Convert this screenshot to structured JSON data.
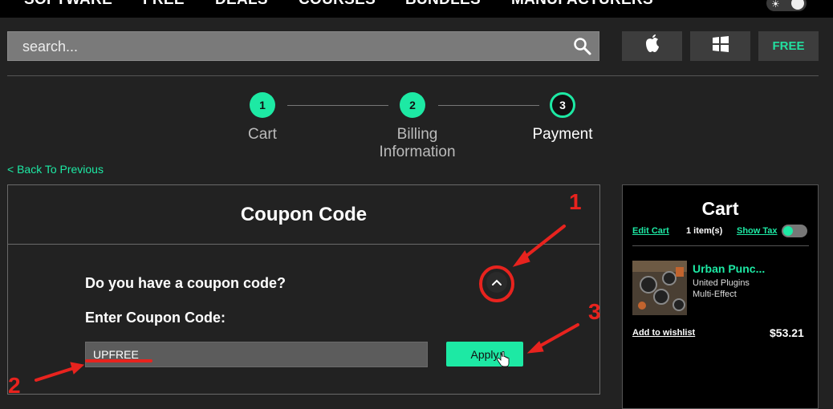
{
  "nav": {
    "items": [
      "SOFTWARE",
      "FREE",
      "DEALS",
      "COURSES",
      "BUNDLES",
      "MANUFACTURERS"
    ]
  },
  "search": {
    "placeholder": "search..."
  },
  "platform_buttons": {
    "apple_icon": "apple-icon",
    "windows_icon": "windows-icon",
    "free_label": "FREE"
  },
  "steps": [
    {
      "number": "1",
      "label": "Cart"
    },
    {
      "number": "2",
      "label": "Billing",
      "label2": "Information"
    },
    {
      "number": "3",
      "label": "Payment"
    }
  ],
  "back_link": "< Back To Previous",
  "coupon": {
    "title": "Coupon Code",
    "question": "Do you have a coupon code?",
    "enter_label": "Enter Coupon Code:",
    "value": "UPFREE",
    "apply_label": "Apply"
  },
  "cart": {
    "title": "Cart",
    "edit_label": "Edit Cart",
    "items_count": "1 item(s)",
    "show_tax_label": "Show Tax",
    "product": {
      "name": "Urban Punc...",
      "vendor": "United Plugins",
      "type": "Multi-Effect",
      "price": "$53.21"
    },
    "wishlist_label": "Add to wishlist"
  },
  "annotations": [
    "1",
    "2",
    "3"
  ],
  "colors": {
    "accent": "#1de9a4",
    "annotation": "#e8231e",
    "background": "#222222"
  }
}
